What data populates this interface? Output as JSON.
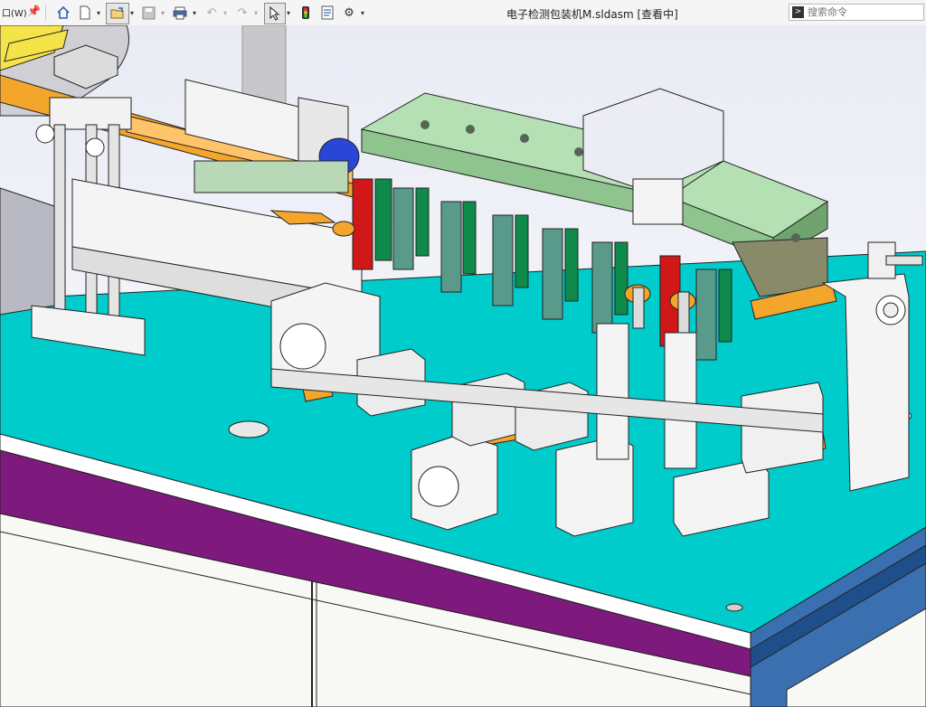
{
  "window": {
    "title": "电子检测包装机M.sldasm [查看中]",
    "menu_fragment": "口(W)"
  },
  "search": {
    "placeholder": "搜索命令"
  },
  "toolbar": {
    "icons": [
      "home-icon",
      "new-document-icon",
      "open-icon",
      "save-icon",
      "print-icon",
      "undo-icon",
      "redo-icon",
      "select-pointer-icon",
      "rebuild-traffic-light-icon",
      "file-properties-icon",
      "options-gear-icon"
    ]
  },
  "headsup_toolbar": {
    "icons": [
      "zoom-to-fit-icon",
      "zoom-to-area-icon",
      "previous-view-icon",
      "section-view-icon",
      "view-orientation-icon",
      "display-style-icon",
      "hide-show-items-icon",
      "edit-appearance-icon",
      "apply-scene-icon",
      "view-settings-icon"
    ]
  },
  "colors": {
    "table_top": "#00cccc",
    "table_apron": "#7e1a7e",
    "cabinet": "#f8f8f4",
    "side_panel": "#3a6fb0",
    "rail_orange": "#f4a52c",
    "plate_green": "#b4e0b4",
    "red_block": "#d01818",
    "dark_green": "#0f8a4a",
    "yellow_part": "#f5e34a",
    "blue_motor": "#2a46d6"
  }
}
